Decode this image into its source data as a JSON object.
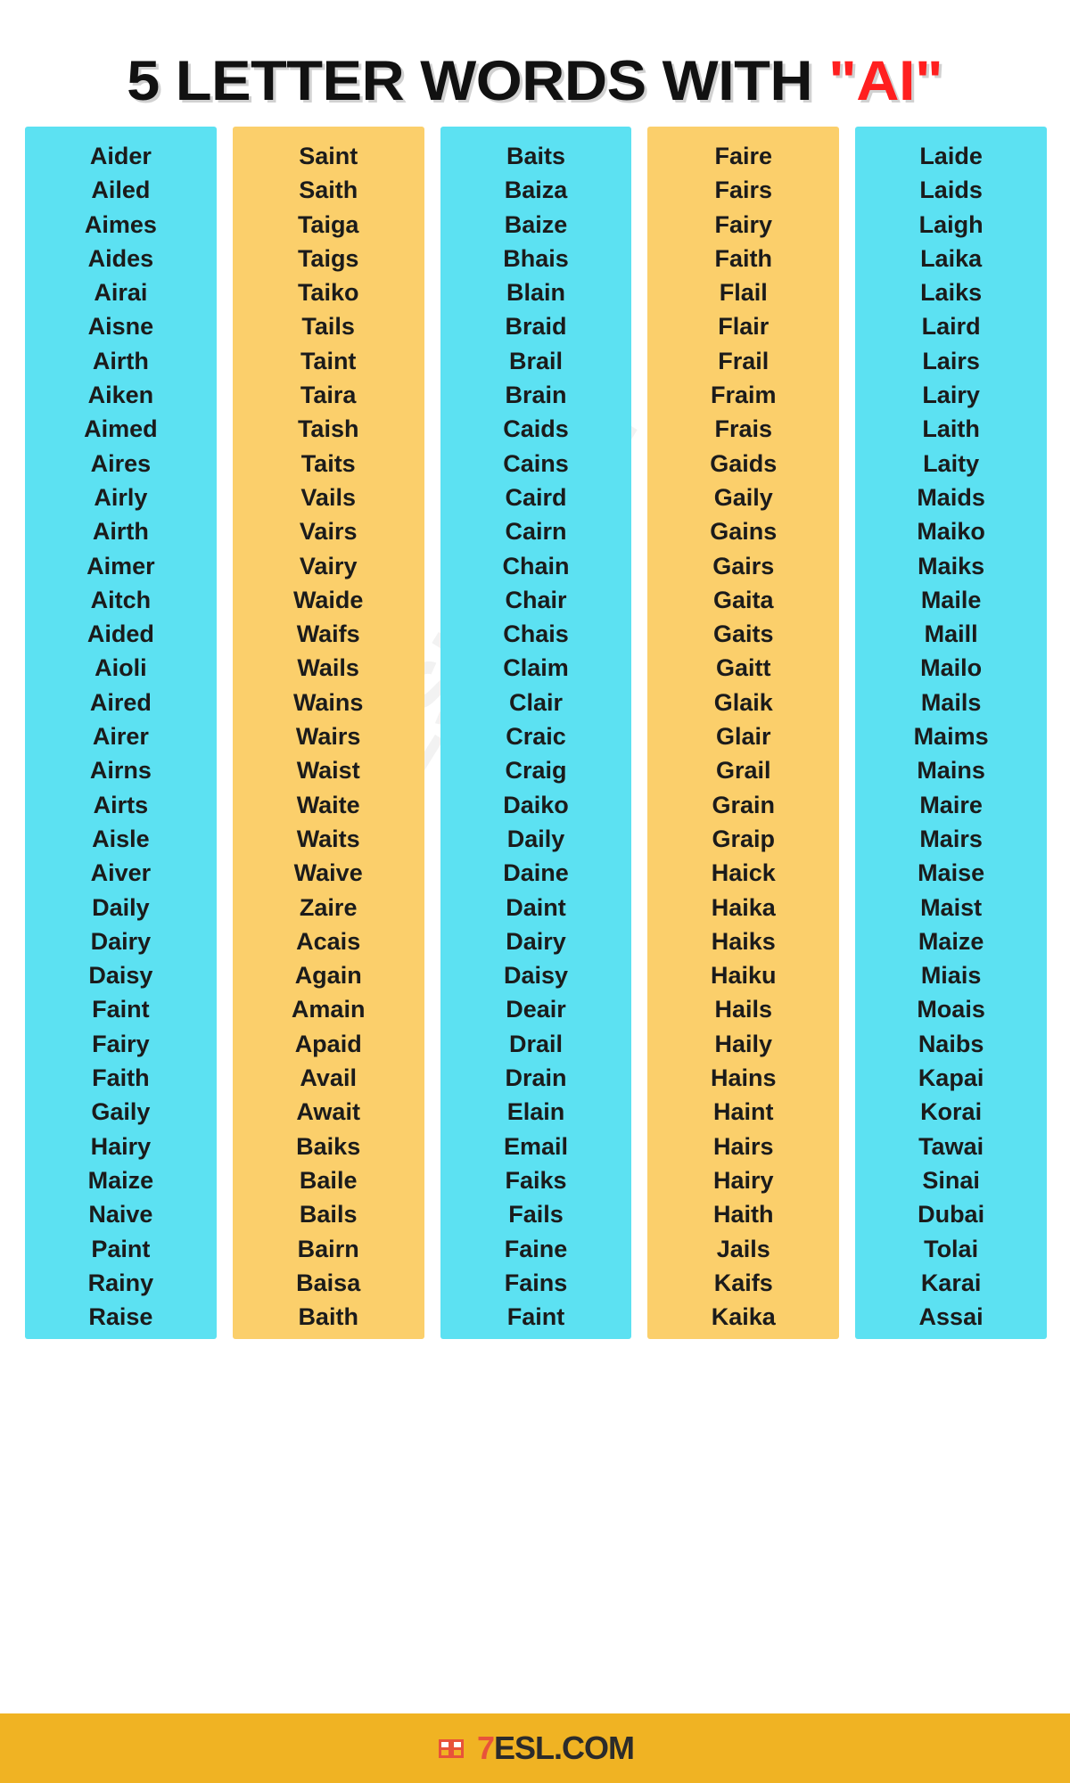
{
  "title": {
    "main": "5 LETTER WORDS WITH ",
    "highlight": "\"AI\"",
    "highlight_color": "#ff1f1f"
  },
  "watermark": {
    "text": "7ESL.COM"
  },
  "theme": {
    "cyan": "#5ce1f2",
    "yellow": "#fbcf6b",
    "footer_bg": "#f0b323",
    "text": "#1b1b1b"
  },
  "footer": {
    "logo_text": "7ESL.COM",
    "logo_accent": "7",
    "logo_accent_color": "#e8533a"
  },
  "columns": [
    {
      "index": 1,
      "color": "cyan",
      "words": [
        "Aider",
        "Ailed",
        "Aimes",
        "Aides",
        "Airai",
        "Aisne",
        "Airth",
        "Aiken",
        "Aimed",
        "Aires",
        "Airly",
        "Airth",
        "Aimer",
        "Aitch",
        "Aided",
        "Aioli",
        "Aired",
        "Airer",
        "Airns",
        "Airts",
        "Aisle",
        "Aiver",
        "Daily",
        "Dairy",
        "Daisy",
        "Faint",
        "Fairy",
        "Faith",
        "Gaily",
        "Hairy",
        "Maize",
        "Naive",
        "Paint",
        "Rainy",
        "Raise"
      ]
    },
    {
      "index": 2,
      "color": "yellow",
      "words": [
        "Saint",
        "Saith",
        "Taiga",
        "Taigs",
        "Taiko",
        "Tails",
        "Taint",
        "Taira",
        "Taish",
        "Taits",
        "Vails",
        "Vairs",
        "Vairy",
        "Waide",
        "Waifs",
        "Wails",
        "Wains",
        "Wairs",
        "Waist",
        "Waite",
        "Waits",
        "Waive",
        "Zaire",
        "Acais",
        "Again",
        "Amain",
        "Apaid",
        "Avail",
        "Await",
        "Baiks",
        "Baile",
        "Bails",
        "Bairn",
        "Baisa",
        "Baith"
      ]
    },
    {
      "index": 3,
      "color": "cyan",
      "words": [
        "Baits",
        "Baiza",
        "Baize",
        "Bhais",
        "Blain",
        "Braid",
        "Brail",
        "Brain",
        "Caids",
        "Cains",
        "Caird",
        "Cairn",
        "Chain",
        "Chair",
        "Chais",
        "Claim",
        "Clair",
        "Craic",
        "Craig",
        "Daiko",
        "Daily",
        "Daine",
        "Daint",
        "Dairy",
        "Daisy",
        "Deair",
        "Drail",
        "Drain",
        "Elain",
        "Email",
        "Faiks",
        "Fails",
        "Faine",
        "Fains",
        "Faint"
      ]
    },
    {
      "index": 4,
      "color": "yellow",
      "words": [
        "Faire",
        "Fairs",
        "Fairy",
        "Faith",
        "Flail",
        "Flair",
        "Frail",
        "Fraim",
        "Frais",
        "Gaids",
        "Gaily",
        "Gains",
        "Gairs",
        "Gaita",
        "Gaits",
        "Gaitt",
        "Glaik",
        "Glair",
        "Grail",
        "Grain",
        "Graip",
        "Haick",
        "Haika",
        "Haiks",
        "Haiku",
        "Hails",
        "Haily",
        "Hains",
        "Haint",
        "Hairs",
        "Hairy",
        "Haith",
        "Jails",
        "Kaifs",
        "Kaika"
      ]
    },
    {
      "index": 5,
      "color": "cyan",
      "words": [
        "Laide",
        "Laids",
        "Laigh",
        "Laika",
        "Laiks",
        "Laird",
        "Lairs",
        "Lairy",
        "Laith",
        "Laity",
        "Maids",
        "Maiko",
        "Maiks",
        "Maile",
        "Maill",
        "Mailo",
        "Mails",
        "Maims",
        "Mains",
        "Maire",
        "Mairs",
        "Maise",
        "Maist",
        "Maize",
        "Miais",
        "Moais",
        "Naibs",
        "Kapai",
        "Korai",
        "Tawai",
        "Sinai",
        "Dubai",
        "Tolai",
        "Karai",
        "Assai"
      ]
    }
  ]
}
